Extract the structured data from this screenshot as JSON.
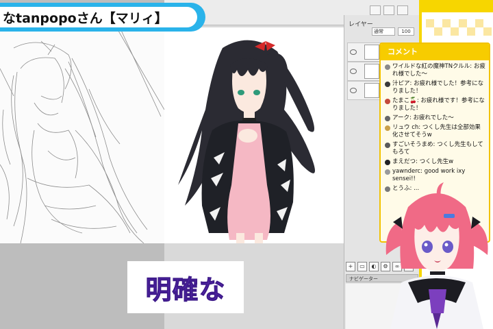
{
  "title_banner": {
    "name": "なtanpopoさん",
    "bracket": "【マリィ】"
  },
  "caption": "明確な",
  "layer_panel": {
    "tab": "レイヤー",
    "blend": "通常",
    "opacity": "100",
    "navigator_tab": "ナビゲーター"
  },
  "chat": {
    "header": "コメント",
    "messages": [
      {
        "name": "",
        "text": "ワイルドな紅の魔神TNクルル: お疲れ様でした〜",
        "color": "#8a8a8a"
      },
      {
        "name": "",
        "text": "汁ピア: お疲れ様でした！参考になりました！",
        "color": "#3a3a3a"
      },
      {
        "name": "",
        "text": "たまこ🍒: お疲れ様です！参考になりました！",
        "color": "#c44a3a"
      },
      {
        "name": "",
        "text": "アーク: お疲れでした〜",
        "color": "#666666"
      },
      {
        "name": "",
        "text": "リュウ ch: つくし先生は全部効果化させてそうw",
        "color": "#c9a04a"
      },
      {
        "name": "",
        "text": "すごいそうまめ: つくし先生もしてもろて",
        "color": "#5a5a5a"
      },
      {
        "name": "",
        "text": "まえだつ: つくし先生w",
        "color": "#222222"
      },
      {
        "name": "",
        "text": "yawnderc: good work ixy sensei!!",
        "color": "#9a9a9a"
      },
      {
        "name": "",
        "text": "とうふ: ...",
        "color": "#7a7a7a"
      }
    ]
  },
  "colors": {
    "banner": "#2ab3ea",
    "chat_border": "#f2c200",
    "caption_text": "#5b2bb5",
    "deco_yellow": "#f7d600"
  }
}
